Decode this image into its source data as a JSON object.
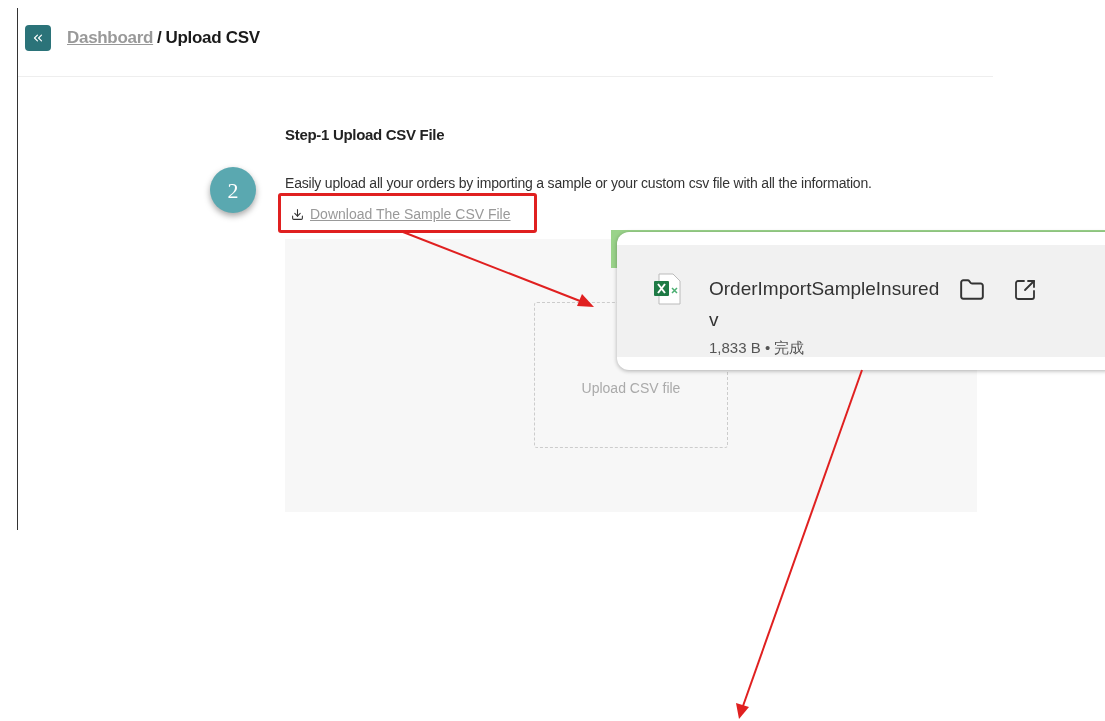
{
  "breadcrumb": {
    "parent": "Dashboard",
    "separator": "/",
    "current": "Upload CSV"
  },
  "step": {
    "title": "Step-1 Upload CSV File",
    "description": "Easily upload all your orders by importing a sample or your custom csv file with all the information.",
    "download_link": "Download The Sample CSV File"
  },
  "dropzone": {
    "label": "Upload CSV file"
  },
  "download_popup": {
    "filename_lines": [
      "OrderImportSampleInsured",
      "v"
    ],
    "status": "1,833 B • 完成"
  },
  "annotation": {
    "badge": "2"
  }
}
